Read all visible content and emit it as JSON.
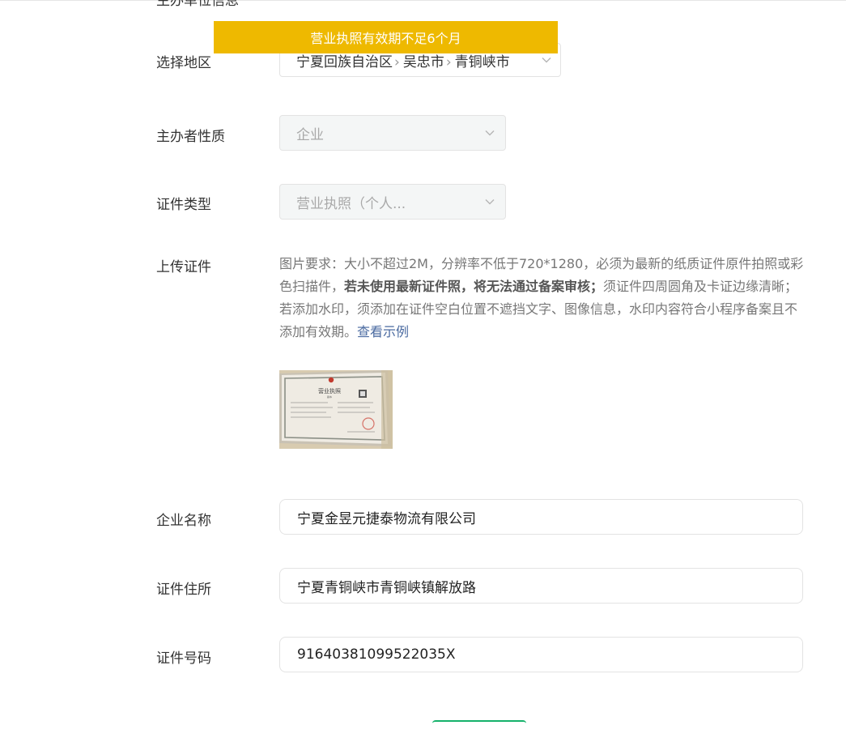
{
  "section": {
    "heading": "主办单位信息"
  },
  "toast": {
    "message": "营业执照有效期不足6个月"
  },
  "region": {
    "label": "选择地区",
    "path": [
      "宁夏回族自治区",
      "吴忠市",
      "青铜峡市"
    ]
  },
  "organizer_type": {
    "label": "主办者性质",
    "value": "企业"
  },
  "cert_type": {
    "label": "证件类型",
    "value": "营业执照（个人..."
  },
  "upload": {
    "label": "上传证件",
    "requirement_part1": "图片要求：大小不超过2M，分辨率不低于720*1280，必须为最新的纸质证件原件拍照或彩色扫描件，",
    "requirement_bold": "若未使用最新证件照，将无法通过备案审核；",
    "requirement_part2": "须证件四周圆角及卡证边缘清晰；若添加水印，须添加在证件空白位置不遮挡文字、图像信息，水印内容符合小程序备案且不添加有效期。",
    "example_link": "查看示例",
    "thumbnail": {
      "title": "营业执照",
      "subtitle": "副本"
    }
  },
  "company_name": {
    "label": "企业名称",
    "value": "宁夏金昱元捷泰物流有限公司"
  },
  "cert_address": {
    "label": "证件住所",
    "value": "宁夏青铜峡市青铜峡镇解放路"
  },
  "cert_number": {
    "label": "证件号码",
    "value": "91640381099522035X"
  },
  "colors": {
    "toast_bg": "#eeb900",
    "disabled_bg": "#f4f6f6",
    "link": "#4a6aa0",
    "primary_green": "#15b26b"
  }
}
